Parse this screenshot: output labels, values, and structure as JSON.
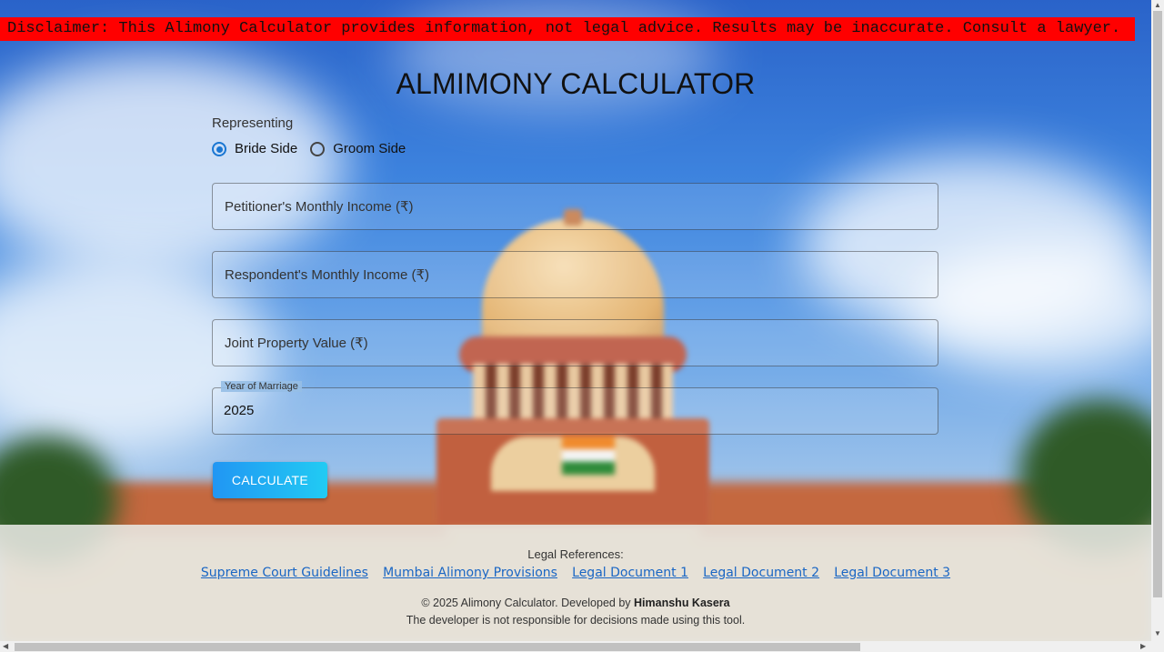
{
  "disclaimer": "Disclaimer: This Alimony Calculator provides information, not legal advice. Results may be inaccurate. Consult a lawyer.",
  "title": "ALMIMONY CALCULATOR",
  "representing": {
    "label": "Representing",
    "options": [
      "Bride Side",
      "Groom Side"
    ],
    "selected": "Bride Side"
  },
  "fields": {
    "petitioner_income_placeholder": "Petitioner's Monthly Income (₹)",
    "respondent_income_placeholder": "Respondent's Monthly Income (₹)",
    "joint_property_placeholder": "Joint Property Value (₹)",
    "year_of_marriage_label": "Year of Marriage",
    "year_of_marriage_value": "2025"
  },
  "calculate_label": "CALCULATE",
  "footer": {
    "legal_title": "Legal References:",
    "links": [
      "Supreme Court Guidelines",
      "Mumbai Alimony Provisions",
      "Legal Document 1",
      "Legal Document 2",
      "Legal Document 3"
    ],
    "copyright_prefix": "© 2025 Alimony Calculator. Developed by",
    "developer": "Himanshu Kasera",
    "note": "The developer is not responsible for decisions made using this tool."
  },
  "colors": {
    "disclaimer_bg": "#ff0000",
    "accent": "#1976d2",
    "link": "#1a66c4"
  }
}
